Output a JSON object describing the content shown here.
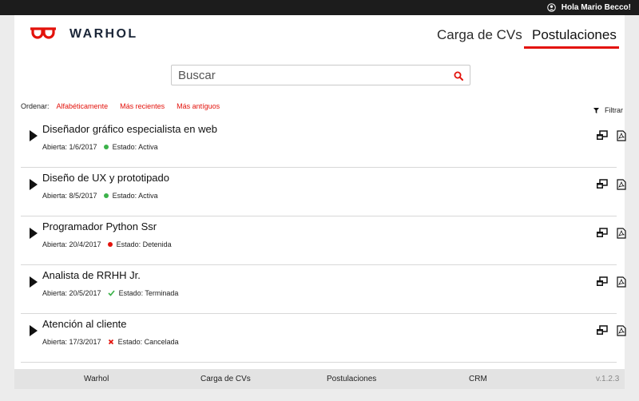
{
  "header": {
    "greeting": "Hola Mario Becco!",
    "user_icon": "user-circle-icon"
  },
  "brand": {
    "name": "WARHOL",
    "logo_icon": "warhol-glasses-logo",
    "accent": "#e3120b"
  },
  "nav": {
    "carga": "Carga de CVs",
    "postulaciones": "Postulaciones"
  },
  "search": {
    "placeholder": "Buscar",
    "value": ""
  },
  "sort": {
    "label": "Ordenar:",
    "options": [
      "Alfabéticamente",
      "Más recientes",
      "Más antíguos"
    ]
  },
  "filter": {
    "label": "Filtrar"
  },
  "jobs": [
    {
      "title": "Diseñador gráfico especialista en web",
      "opened": "Abierta: 1/6/2017",
      "status": "Estado: Activa",
      "status_icon": "green-dot",
      "status_color": "#3cb24a"
    },
    {
      "title": "Diseño de UX y prototipado",
      "opened": "Abierta: 8/5/2017",
      "status": "Estado: Activa",
      "status_icon": "green-dot",
      "status_color": "#3cb24a"
    },
    {
      "title": "Programador Python Ssr",
      "opened": "Abierta: 20/4/2017",
      "status": "Estado: Detenida",
      "status_icon": "red-dot",
      "status_color": "#e3120b"
    },
    {
      "title": "Analista de RRHH Jr.",
      "opened": "Abierta: 20/5/2017",
      "status": "Estado: Terminada",
      "status_icon": "check-icon",
      "status_color": "#3cb24a"
    },
    {
      "title": "Atención al cliente",
      "opened": "Abierta: 17/3/2017",
      "status": "Estado: Cancelada",
      "status_icon": "x-icon",
      "status_color": "#e3120b"
    }
  ],
  "footer": {
    "links": [
      "Warhol",
      "Carga de CVs",
      "Postulaciones",
      "CRM"
    ],
    "version": "v.1.2.3"
  }
}
